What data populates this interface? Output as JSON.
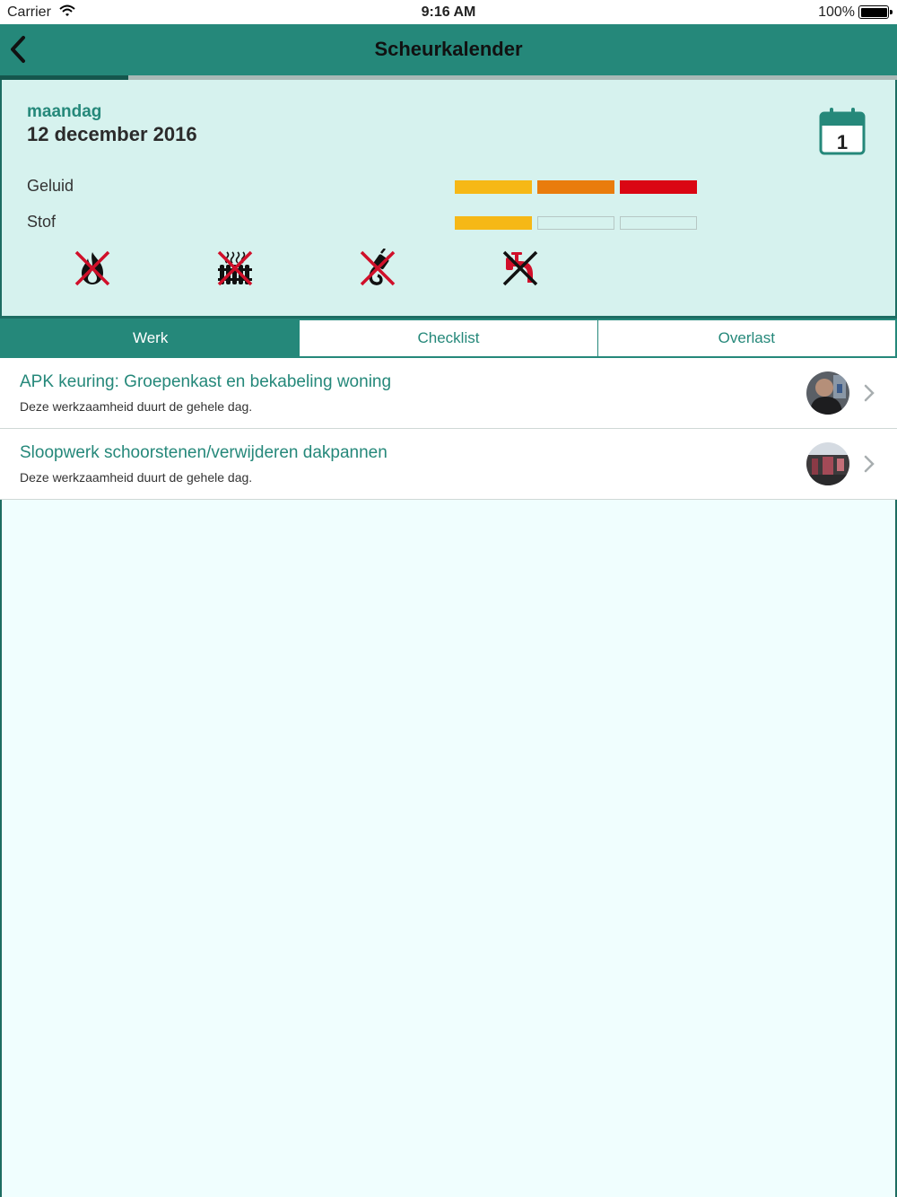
{
  "status": {
    "carrier": "Carrier",
    "time": "9:16 AM",
    "battery": "100%"
  },
  "nav": {
    "title": "Scheurkalender"
  },
  "progress": {
    "fraction": 0.143
  },
  "day": {
    "weekday": "maandag",
    "date": "12 december 2016",
    "calendar_badge": "1",
    "metrics": [
      {
        "label": "Geluid",
        "levels": [
          "#f6b816",
          "#e97c0c",
          "#da0613"
        ]
      },
      {
        "label": "Stof",
        "levels": [
          "#f6b816",
          null,
          null
        ]
      }
    ],
    "hazard_icons": [
      "no-fire-icon",
      "no-heating-icon",
      "no-power-icon",
      "no-water-icon"
    ]
  },
  "tabs": [
    {
      "label": "Werk",
      "active": true
    },
    {
      "label": "Checklist",
      "active": false
    },
    {
      "label": "Overlast",
      "active": false
    }
  ],
  "tasks": [
    {
      "title": "APK keuring: Groepenkast en bekabeling woning",
      "subtitle": "Deze werkzaamheid duurt de gehele dag."
    },
    {
      "title": "Sloopwerk schoorstenen/verwijderen dakpannen",
      "subtitle": "Deze werkzaamheid duurt de gehele dag."
    }
  ],
  "colors": {
    "brand": "#25887a",
    "panel": "#d6f2ee",
    "background": "#f0fefe",
    "warning_red": "#d0102a"
  }
}
